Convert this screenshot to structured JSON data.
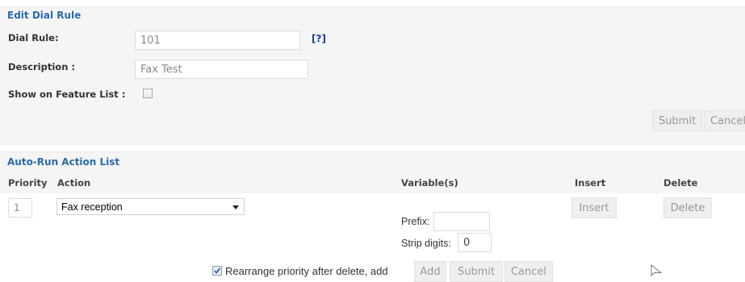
{
  "edit_dial_rule": {
    "title": "Edit Dial Rule",
    "dial_rule_label": "Dial Rule:",
    "dial_rule_value": "101",
    "help_link": "[?]",
    "description_label": "Description :",
    "description_value": "Fax Test",
    "show_feature_label": "Show on Feature List :",
    "show_feature_checked": false,
    "submit_label": "Submit",
    "cancel_label": "Cancel"
  },
  "auto_run": {
    "title": "Auto-Run Action List",
    "headers": {
      "priority": "Priority",
      "action": "Action",
      "variables": "Variable(s)",
      "insert": "Insert",
      "delete": "Delete"
    },
    "rows": [
      {
        "priority": "1",
        "action": "Fax reception",
        "prefix_label": "Prefix:",
        "prefix_value": "",
        "strip_label": "Strip digits:",
        "strip_value": "0",
        "insert_label": "Insert",
        "delete_label": "Delete"
      }
    ],
    "footer": {
      "rearrange_checked": true,
      "rearrange_label": "Rearrange priority after delete, add",
      "add_label": "Add",
      "submit_label": "Submit",
      "cancel_label": "Cancel"
    }
  },
  "colors": {
    "accent": "#2e6aa8",
    "panel_bg": "#f5f5f5"
  }
}
